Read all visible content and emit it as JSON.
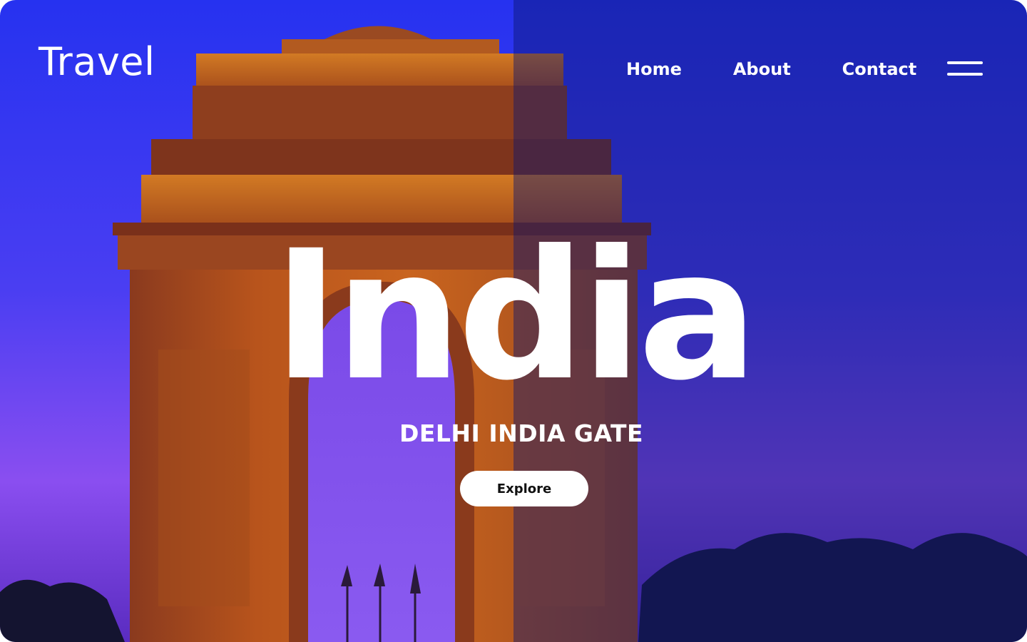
{
  "header": {
    "logo": "Travel",
    "nav": [
      {
        "label": "Home"
      },
      {
        "label": "About"
      },
      {
        "label": "Contact"
      }
    ],
    "menu_icon": "hamburger-menu-icon"
  },
  "hero": {
    "title": "India",
    "subtitle": "DELHI INDIA GATE",
    "cta_label": "Explore",
    "background_image": "india-gate-photo",
    "overlay_color": "#1a2aa8"
  },
  "colors": {
    "sky_top": "#2a3af0",
    "sky_bottom": "#7a44e0",
    "monument_lit": "#c8621e",
    "monument_shadow": "#6a2a22",
    "text": "#ffffff",
    "button_bg": "#ffffff",
    "button_text": "#111111"
  }
}
